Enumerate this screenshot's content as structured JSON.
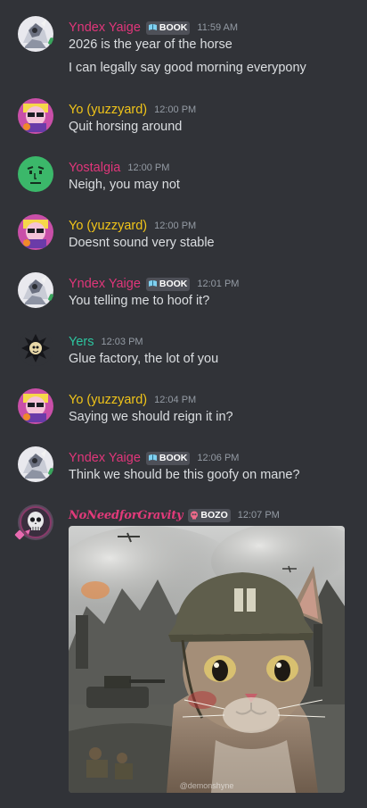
{
  "messages": [
    {
      "author": "Yndex Yaige",
      "tag": "BOOK",
      "time": "11:59 AM",
      "lines": [
        "2026 is the year of the horse",
        "I can legally say good morning everypony"
      ]
    },
    {
      "author": "Yo (yuzzyard)",
      "time": "12:00 PM",
      "lines": [
        "Quit horsing around"
      ]
    },
    {
      "author": "Yostalgia",
      "time": "12:00 PM",
      "lines": [
        "Neigh, you may not"
      ]
    },
    {
      "author": "Yo (yuzzyard)",
      "time": "12:00 PM",
      "lines": [
        "Doesnt sound very stable"
      ]
    },
    {
      "author": "Yndex Yaige",
      "tag": "BOOK",
      "time": "12:01 PM",
      "lines": [
        "You telling me to hoof it?"
      ]
    },
    {
      "author": "Yers",
      "time": "12:03 PM",
      "lines": [
        "Glue factory, the lot of you"
      ]
    },
    {
      "author": "Yo (yuzzyard)",
      "time": "12:04 PM",
      "lines": [
        "Saying we should reign it in?"
      ]
    },
    {
      "author": "Yndex Yaige",
      "tag": "BOOK",
      "time": "12:06 PM",
      "lines": [
        "Think we should be this goofy on mane?"
      ]
    },
    {
      "author": "NoNeedforGravity",
      "tag": "BOZO",
      "time": "12:07 PM",
      "attachment": {
        "description": "cat wearing a soldier helmet in a war scene",
        "watermark": "@demonshyne"
      }
    }
  ],
  "colors": {
    "background": "#313338",
    "text": "#dbdee1",
    "timestamp": "#949ba4",
    "name_pink": "#e0367a",
    "name_yellow": "#f0c419",
    "name_teal": "#2dc49f",
    "tag_bg": "#4e5058"
  },
  "icons": {
    "book_tag": "book-icon",
    "bozo_tag": "skull-icon"
  }
}
